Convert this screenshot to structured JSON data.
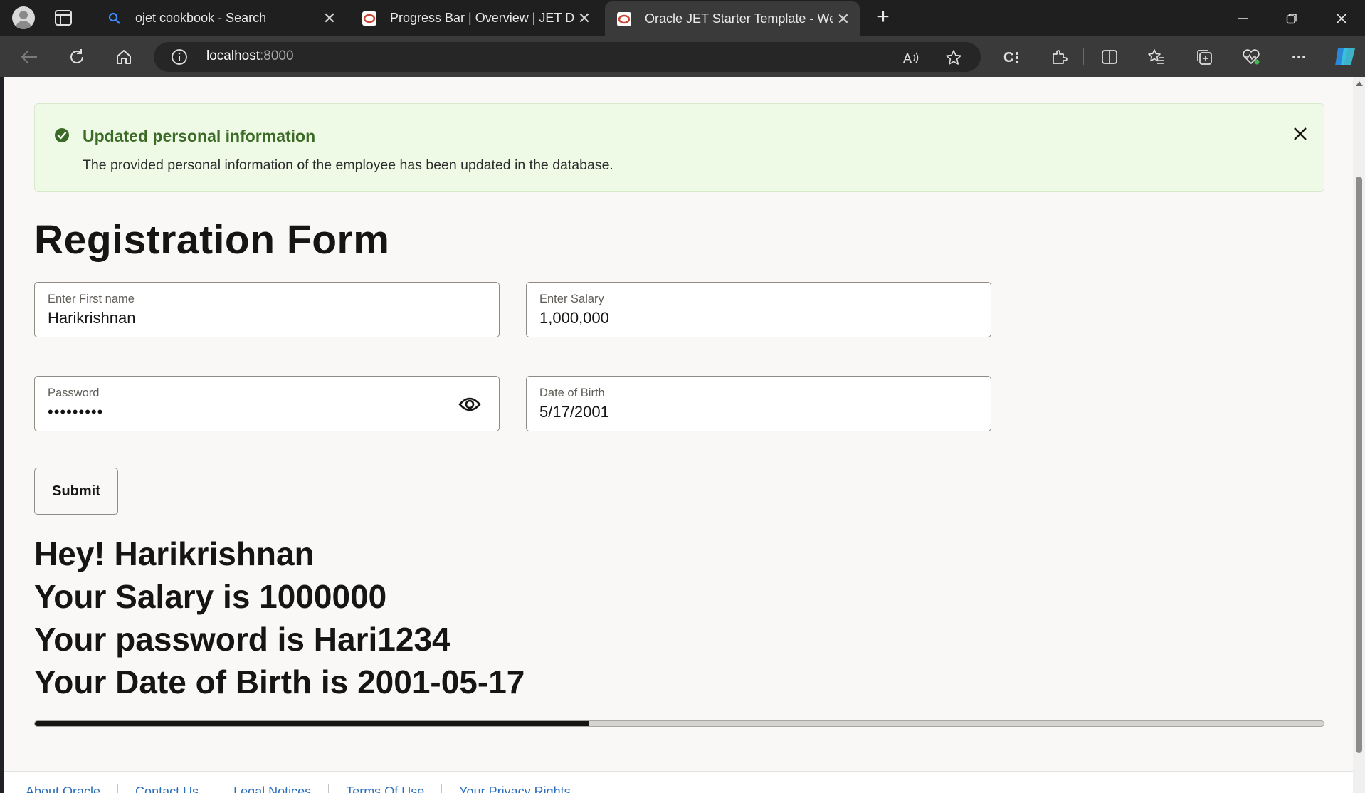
{
  "browser": {
    "tabs": [
      {
        "title": "ojet cookbook - Search",
        "icon": "search-icon"
      },
      {
        "title": "Progress Bar | Overview | JET Dev",
        "icon": "jet-favicon"
      },
      {
        "title": "Oracle JET Starter Template - Wel",
        "icon": "jet-favicon",
        "active": true
      }
    ],
    "address": {
      "host": "localhost",
      "port": ":8000"
    }
  },
  "banner": {
    "title": "Updated personal information",
    "message": "The provided personal information of the employee has been updated in the database."
  },
  "form": {
    "title": "Registration Form",
    "first_name": {
      "label": "Enter First name",
      "value": "Harikrishnan"
    },
    "salary": {
      "label": "Enter Salary",
      "value": "1,000,000"
    },
    "password": {
      "label": "Password",
      "masked_value": "•••••••••"
    },
    "dob": {
      "label": "Date of Birth",
      "value": "5/17/2001"
    },
    "submit_label": "Submit"
  },
  "output": {
    "greeting": "Hey! Harikrishnan",
    "salary_line": "Your Salary is 1000000",
    "password_line": "Your password is Hari1234",
    "dob_line": "Your Date of Birth is 2001-05-17"
  },
  "progress": {
    "value_percent": 43
  },
  "footer": {
    "links": [
      "About Oracle",
      "Contact Us",
      "Legal Notices",
      "Terms Of Use",
      "Your Privacy Rights"
    ]
  },
  "colors": {
    "banner_bg": "#eefae6",
    "banner_title": "#3b6b26",
    "progress_fill": "#161513",
    "link": "#2a6ebb"
  }
}
